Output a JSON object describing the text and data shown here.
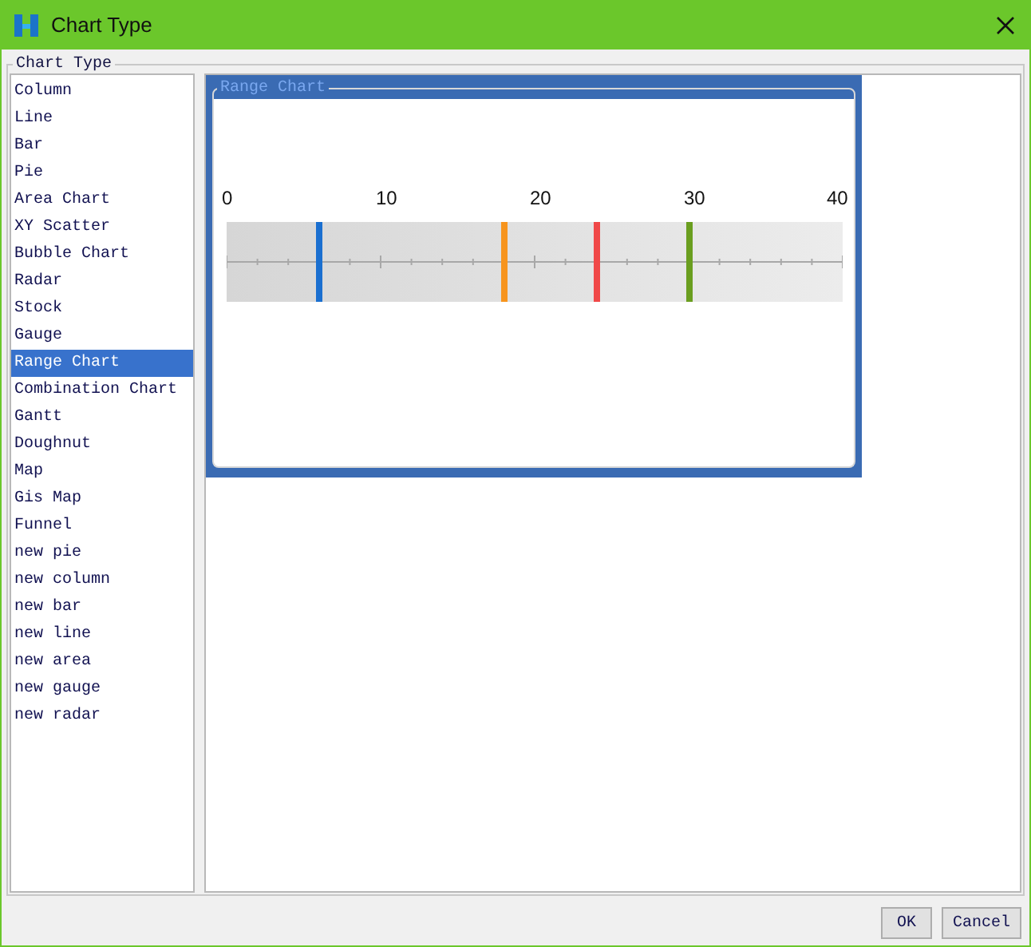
{
  "window": {
    "title": "Chart Type"
  },
  "group": {
    "title": "Chart Type"
  },
  "chart_types": [
    {
      "label": "Column",
      "selected": false
    },
    {
      "label": "Line",
      "selected": false
    },
    {
      "label": "Bar",
      "selected": false
    },
    {
      "label": "Pie",
      "selected": false
    },
    {
      "label": "Area Chart",
      "selected": false
    },
    {
      "label": "XY Scatter",
      "selected": false
    },
    {
      "label": "Bubble Chart",
      "selected": false
    },
    {
      "label": "Radar",
      "selected": false
    },
    {
      "label": "Stock",
      "selected": false
    },
    {
      "label": "Gauge",
      "selected": false
    },
    {
      "label": "Range Chart",
      "selected": true
    },
    {
      "label": "Combination Chart",
      "selected": false
    },
    {
      "label": "Gantt",
      "selected": false
    },
    {
      "label": "Doughnut",
      "selected": false
    },
    {
      "label": "Map",
      "selected": false
    },
    {
      "label": "Gis Map",
      "selected": false
    },
    {
      "label": "Funnel",
      "selected": false
    },
    {
      "label": "new pie",
      "selected": false
    },
    {
      "label": "new column",
      "selected": false
    },
    {
      "label": "new bar",
      "selected": false
    },
    {
      "label": "new line",
      "selected": false
    },
    {
      "label": "new area",
      "selected": false
    },
    {
      "label": "new gauge",
      "selected": false
    },
    {
      "label": "new radar",
      "selected": false
    }
  ],
  "preview": {
    "title": "Range Chart",
    "tick_labels": [
      "0",
      "10",
      "20",
      "30",
      "40"
    ],
    "markers": [
      {
        "color": "#1a6fd0",
        "level": 0.15
      },
      {
        "color": "#f7941d",
        "level": 0.45
      },
      {
        "color": "#f04848",
        "level": 0.6
      },
      {
        "color": "#6a9e1f",
        "level": 0.75
      }
    ]
  },
  "buttons": [
    "OK",
    "Cancel"
  ]
}
